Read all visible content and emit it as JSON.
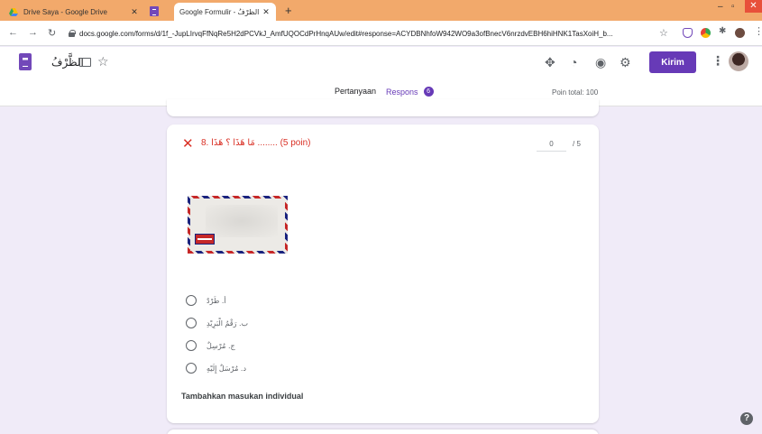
{
  "browser": {
    "tabs": [
      {
        "label": "Drive Saya - Google Drive",
        "active": false
      },
      {
        "label": "Google Formulir - الظَّرْفُ",
        "active": true
      }
    ],
    "new_tab_symbol": "+",
    "url": "docs.google.com/forms/d/1f_-JupLIrvqFfNqRe5H2dPCVkJ_AmfUQOCdPrHnqAUw/edit#response=ACYDBNhfoW942WO9a3ofBnecV6nrzdvEBH6hiHNK1TasXoiH_b...",
    "window_controls": {
      "minimize": "–",
      "maximize": "▫",
      "close": "✕"
    }
  },
  "header": {
    "doc_title": "الظَّرْفُ",
    "send_label": "Kirim"
  },
  "tabs": {
    "questions_label": "Pertanyaan",
    "responses_label": "Respons",
    "responses_count": "6",
    "total_points": "Poin total: 100"
  },
  "question": {
    "title": "8. مَا هَذَا ؟ هَذَا ........ (5 poin)",
    "score_value": "0",
    "score_max": "/ 5",
    "options": [
      {
        "label": "أ. طَرْدٌ"
      },
      {
        "label": "ب. رَقْمُ الْبَرِيْدِ"
      },
      {
        "label": "ج. مُرْسِلٌ"
      },
      {
        "label": "د. مُرْسَلٌ إِلَيْهِ"
      }
    ],
    "feedback_label": "Tambahkan masukan individual"
  },
  "help_symbol": "?",
  "icons": {
    "wrong": "close-x-icon",
    "folder": "folder-icon",
    "star": "star-outline-icon",
    "addon": "puzzle-icon",
    "palette": "palette-icon",
    "preview": "eye-icon",
    "settings": "gear-icon",
    "more": "more-vert-icon"
  },
  "colors": {
    "accent": "#673ab7",
    "error": "#d93025",
    "page_bg": "#f0ebf8",
    "tabstrip": "#f2a96b"
  }
}
